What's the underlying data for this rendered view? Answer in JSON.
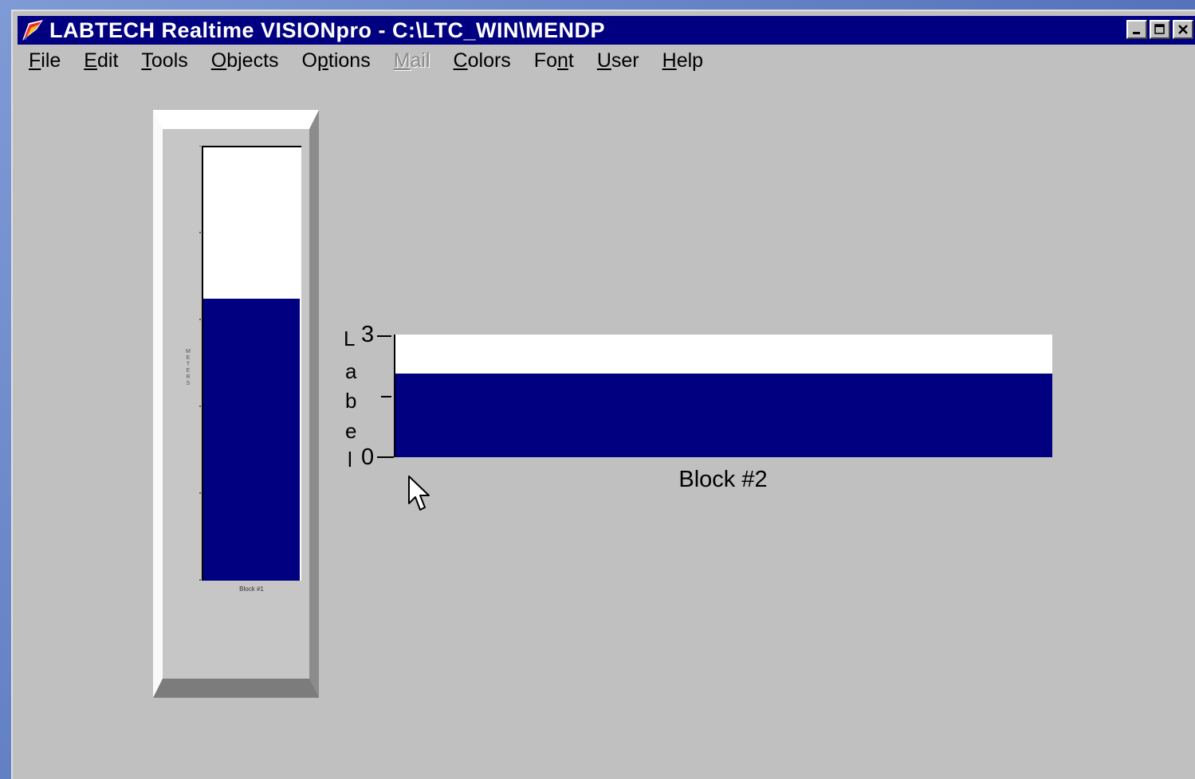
{
  "window": {
    "title": "LABTECH Realtime VISIONpro - C:\\LTC_WIN\\MENDP"
  },
  "menu": [
    {
      "label": "File",
      "accel": "F",
      "rest": "ile",
      "enabled": true
    },
    {
      "label": "Edit",
      "accel": "E",
      "rest": "dit",
      "enabled": true
    },
    {
      "label": "Tools",
      "accel": "T",
      "rest": "ools",
      "enabled": true
    },
    {
      "label": "Objects",
      "accel": "O",
      "rest": "bjects",
      "enabled": true
    },
    {
      "label": "Options",
      "pre": "O",
      "accel": "p",
      "rest": "tions",
      "enabled": true
    },
    {
      "label": "Mail",
      "accel": "M",
      "rest": "ail",
      "enabled": false
    },
    {
      "label": "Colors",
      "accel": "C",
      "rest": "olors",
      "enabled": true
    },
    {
      "label": "Font",
      "pre": "Fo",
      "accel": "n",
      "rest": "t",
      "enabled": true
    },
    {
      "label": "User",
      "accel": "U",
      "rest": "ser",
      "enabled": true
    },
    {
      "label": "Help",
      "accel": "H",
      "rest": "elp",
      "enabled": true
    }
  ],
  "vertical_gauge": {
    "fill_fraction": 0.65,
    "fill_color": "#000080",
    "axis_label": "METERS",
    "caption": "Block #1"
  },
  "horizontal_gauge": {
    "axis_label_letters": [
      "L",
      "a",
      "b",
      "e",
      "l"
    ],
    "tick_max_label": "3",
    "tick_min_label": "0",
    "fill_fraction": 0.68,
    "fill_color": "#000080",
    "caption": "Block #2"
  }
}
